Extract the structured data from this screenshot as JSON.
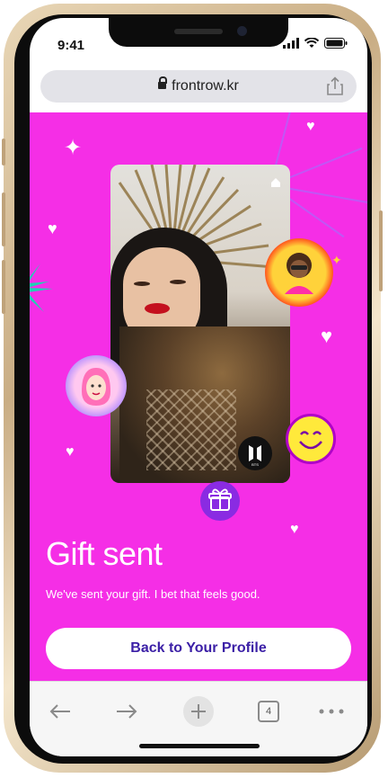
{
  "status_bar": {
    "time": "9:41"
  },
  "browser": {
    "url": "frontrow.kr",
    "tab_count": "4"
  },
  "page": {
    "title": "Gift sent",
    "subtitle": "We've sent your gift. I bet that feels good.",
    "button_label": "Back to Your Profile",
    "background_color": "#f52ee6",
    "accent_color": "#8a2be2"
  },
  "icons": [
    "lock-icon",
    "share-icon",
    "sparkle-icon",
    "heart-icon",
    "home-icon",
    "bts-logo-icon",
    "gift-icon",
    "back-arrow-icon",
    "forward-arrow-icon",
    "new-tab-plus-icon",
    "tabs-icon",
    "more-icon"
  ]
}
